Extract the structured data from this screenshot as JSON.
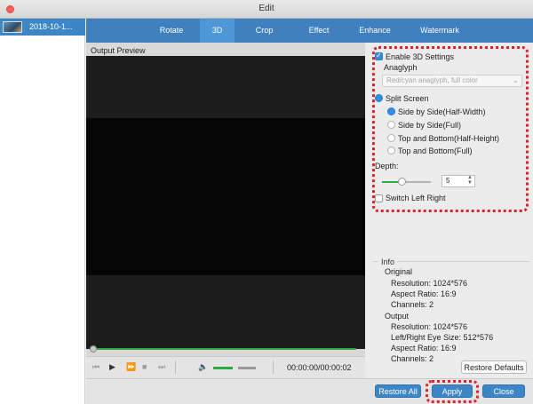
{
  "window": {
    "title": "Edit"
  },
  "file_list": {
    "items": [
      {
        "name": "2018-10-1..."
      }
    ]
  },
  "tabs": [
    {
      "label": "Rotate",
      "active": false
    },
    {
      "label": "3D",
      "active": true
    },
    {
      "label": "Crop",
      "active": false
    },
    {
      "label": "Effect",
      "active": false
    },
    {
      "label": "Enhance",
      "active": false
    },
    {
      "label": "Watermark",
      "active": false
    }
  ],
  "preview": {
    "label": "Output Preview",
    "timecode": "00:00:00/00:00:02",
    "progress": 0.0,
    "volume_level": 0.45
  },
  "settings": {
    "enable_3d_label": "Enable 3D Settings",
    "enable_3d_checked": true,
    "anaglyph_label": "Anaglyph",
    "anaglyph_option": "Red/cyan anaglyph, full color",
    "split_screen_label": "Split Screen",
    "split_screen_selected": true,
    "split_options": [
      {
        "label": "Side by Side(Half-Width)",
        "selected": true
      },
      {
        "label": "Side by Side(Full)",
        "selected": false
      },
      {
        "label": "Top and Bottom(Half-Height)",
        "selected": false
      },
      {
        "label": "Top and Bottom(Full)",
        "selected": false
      }
    ],
    "depth_label": "Depth:",
    "depth_value": "5",
    "switch_label": "Switch Left Right",
    "switch_checked": false
  },
  "info": {
    "legend": "Info",
    "original_label": "Original",
    "original": {
      "resolution": "Resolution: 1024*576",
      "aspect": "Aspect Ratio: 16:9",
      "channels": "Channels: 2"
    },
    "output_label": "Output",
    "output": {
      "resolution": "Resolution: 1024*576",
      "eye_size": "Left/Right Eye Size: 512*576",
      "aspect": "Aspect Ratio: 16:9",
      "channels": "Channels: 2"
    }
  },
  "buttons": {
    "restore_defaults": "Restore Defaults",
    "restore_all": "Restore All",
    "apply": "Apply",
    "close": "Close"
  },
  "colors": {
    "accent_blue": "#3d86c6",
    "tab_bar": "#3f81bf",
    "progress_green": "#2fa843",
    "highlight_red": "#e0202b"
  }
}
